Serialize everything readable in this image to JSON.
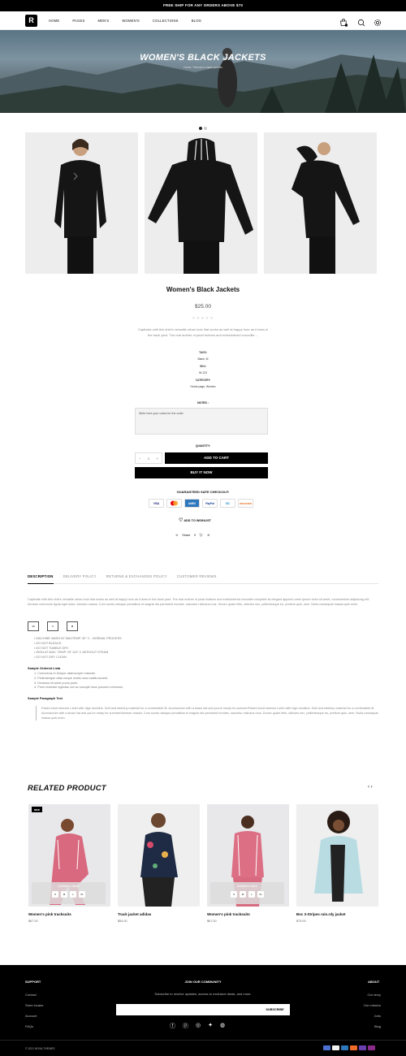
{
  "topbar": {
    "text": "FREE SHIP FOR ANY ORDERS ABOVE $70"
  },
  "header": {
    "nav": [
      "HOME",
      "PAGES",
      "MEN'S",
      "WOMEN'S",
      "COLLECTIONS",
      "BLOG"
    ],
    "cart_count": "0"
  },
  "hero": {
    "title": "WOMEN'S BLACK JACKETS",
    "breadcrumb": "Home / Women's black jackets"
  },
  "product": {
    "title": "Women's Black Jackets",
    "price": "$25.00",
    "stars": "★★★★★",
    "description": "Captivate with this shirt's versatile urban look that works as well at happy hour as it does in the back yard. The real mother of pearl buttons and embroidered crocodile ...",
    "meta": [
      {
        "label": "TAGS:",
        "value": "Black, M"
      },
      {
        "label": "SKU:",
        "value": "W-123"
      },
      {
        "label": "CATEGORY:",
        "value": "Home page, Women"
      }
    ],
    "notes_label": "NOTES :",
    "notes_placeholder": "Write here your notes for the order",
    "qty_label": "QUANTITY:",
    "qty": "1",
    "add_to_cart": "ADD TO CART",
    "buy_now": "BUY IT NOW",
    "guaranteed": "GUARANTEED SAFE CHECKOUT:",
    "payments": [
      "VISA",
      "MC",
      "AMEX",
      "PayPal",
      "DC",
      "DISCOVER"
    ],
    "wishlist": "ADD TO WISHLIST",
    "share": "Share"
  },
  "colors": {
    "accent": "#000000",
    "footer_bg": "#000000",
    "image_bg": "#ededed"
  },
  "tabs": [
    "DESCRIPTION",
    "DELIVERY POLICY",
    "RETURNS & EXCHANGES POLICY",
    "CUSTOMER REVIEWS"
  ],
  "description": {
    "paragraph": "Captivate with this shirt's versatile urban look that works as well at happy hour as it does in the back yard. The real mother of pearl buttons and embroidered crocodile complete its elegant appeal.Lorem ipsum dolor sit amet, consectetuer adipiscing elit. Aenean commodo ligula eget dolor. Aenean massa. Cum sociis natoque penatibus et magnis dis parturient montes, nascetur ridiculus mus. Donec quam felis, ultricies nec, pellentesque eu, pretium quis, sem. Nulla consequat massa quis enim.",
    "care_icons": [
      "30",
      "✕",
      "⊠"
    ],
    "care": [
      "MACHINE WASH AT MAXTEMP. 30° C - NORMAL PROCESS",
      "DO NOT BLEACH",
      "DO NOT TUMBLE DRY",
      "IRON AT MAX. TEMP. OF 110° C WITHOUT STEAM",
      "DO NOT DRY CLEAN"
    ],
    "ordered_title": "Sample Ordered Lista",
    "ordered": [
      "1. Comodous in tempor ullamcorper miaculis",
      "2. Pellentesque vitae neque mollis urna mattis laoreet.",
      "3. Divamus sit amet purus justo.",
      "4. Proin molestie egestas orci ac suscipit risus posuere loremous"
    ],
    "paragraph_title": "Sample Paragraph Text",
    "quote": "Faded short sleeves t-shirt with high neckline. Soft and stretchy material for a comfortable fit. Accessorize with a straw hat and you're ready for summer!Faded short sleeves t-shirt with high neckline. Soft and stretchy material for a comfortable fit. Accessorize with a straw hat and you're ready for summer!Aenean massa. Cum sociis natoque penatibus et magnis dis parturient montes, nascetur ridiculus mus. Donec quam felis, ultricies nec, pellentesque eu, pretium quis, sem. Nulla consequat massa quis enim."
  },
  "related": {
    "title": "RELATED PRODUCT",
    "items": [
      {
        "name": "Women's pink tracksuits",
        "price": "$67.00",
        "badge": "NEW",
        "availability": "Available in black:",
        "sizes": [
          "S",
          "M",
          "L",
          "XL"
        ],
        "bg": "#e9e9ec"
      },
      {
        "name": "Track jacket adidas",
        "price": "$54.00",
        "badge": "",
        "availability": "",
        "sizes": [],
        "bg": "#ececee"
      },
      {
        "name": "Women's pink tracksuits",
        "price": "$67.00",
        "badge": "",
        "availability": "Available in black:",
        "sizes": [
          "S",
          "M",
          "L",
          "XL"
        ],
        "bg": "#e9e9ec"
      },
      {
        "name": "Bsc 3-Stripes rain.rdy jacket",
        "price": "$79.00",
        "badge": "",
        "availability": "",
        "sizes": [],
        "bg": "#ececee"
      }
    ]
  },
  "footer": {
    "support_title": "SUPPORT",
    "support": [
      "Contact",
      "Store locator",
      "Account",
      "FAQs"
    ],
    "community_title": "JOIN OUR COMMUNITY",
    "community_text": "Subscribe to receive updates, access to exclusive deals, and more.",
    "subscribe": "SUBSCRIBE",
    "about_title": "ABOUT",
    "about": [
      "Our story",
      "Our mission",
      "Jobs",
      "Blog"
    ],
    "copyright": "© 2021 NOVA-THEMES"
  }
}
